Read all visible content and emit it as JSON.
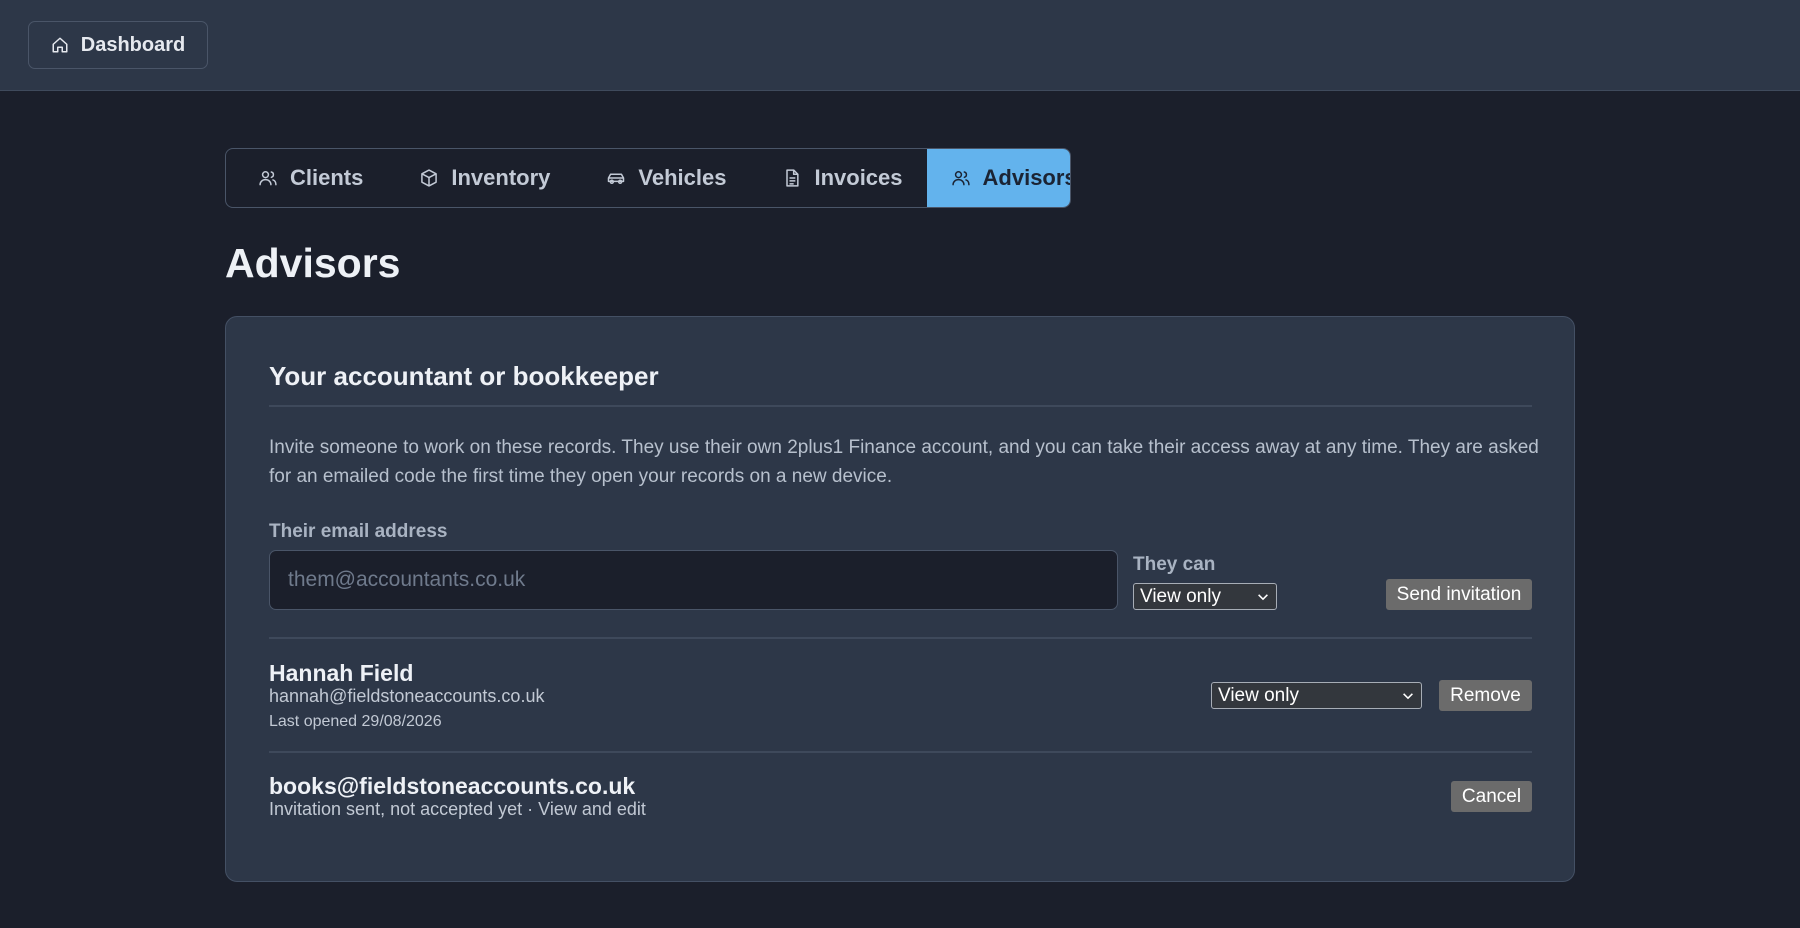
{
  "header": {
    "dashboard_label": "Dashboard",
    "dashboard_icon": "home-icon"
  },
  "tabs": [
    {
      "label": "Clients",
      "icon": "users-icon",
      "active": false
    },
    {
      "label": "Inventory",
      "icon": "box-icon",
      "active": false
    },
    {
      "label": "Vehicles",
      "icon": "car-icon",
      "active": false
    },
    {
      "label": "Invoices",
      "icon": "document-icon",
      "active": false
    },
    {
      "label": "Advisors",
      "icon": "users-icon",
      "active": true
    }
  ],
  "page": {
    "title": "Advisors"
  },
  "card": {
    "title": "Your accountant or bookkeeper",
    "intro": "Invite someone to work on these records. They use their own 2plus1 Finance account, and you can take their access away at any time. They are asked for an emailed code the first time they open your records on a new device.",
    "invite": {
      "email_label": "Their email address",
      "email_placeholder": "them@accountants.co.uk",
      "email_value": "",
      "permission_label": "They can",
      "permission_value": "View only",
      "send_label": "Send invitation"
    },
    "advisors": [
      {
        "name": "Hannah Field",
        "email": "hannah@fieldstoneaccounts.co.uk",
        "last_opened": "Last opened 29/08/2026",
        "permission": "View only",
        "remove_label": "Remove"
      }
    ],
    "pending": [
      {
        "email": "books@fieldstoneaccounts.co.uk",
        "status": "Invitation sent, not accepted yet · View and edit",
        "cancel_label": "Cancel"
      }
    ]
  },
  "colors": {
    "background": "#1b1f2b",
    "panel": "#2d3748",
    "accent": "#63b3ed",
    "button_gray": "#6b6b6b"
  }
}
